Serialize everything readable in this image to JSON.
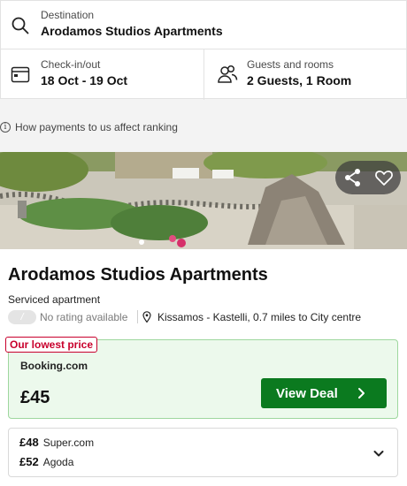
{
  "search": {
    "destination_label": "Destination",
    "destination_value": "Arodamos Studios Apartments",
    "dates_label": "Check-in/out",
    "dates_value": "18 Oct - 19 Oct",
    "guests_label": "Guests and rooms",
    "guests_value": "2 Guests, 1 Room"
  },
  "ranking_note": "How payments to us affect ranking",
  "hotel": {
    "name": "Arodamos Studios Apartments",
    "type": "Serviced apartment",
    "rating_badge": "/",
    "rating_text": "No rating available",
    "location": "Kissamos - Kastelli, 0.7 miles to City centre",
    "photo_actions": [
      "share-icon",
      "heart-icon"
    ]
  },
  "best_deal": {
    "badge": "Our lowest price",
    "provider": "Booking.com",
    "price": "£45",
    "button_label": "View Deal"
  },
  "other_offers": [
    {
      "price": "£48",
      "site": "Super.com"
    },
    {
      "price": "£52",
      "site": "Agoda"
    }
  ],
  "colors": {
    "deal_button": "#0b7a1f",
    "deal_background": "#ecf9ec",
    "badge_red": "#c8002c"
  }
}
